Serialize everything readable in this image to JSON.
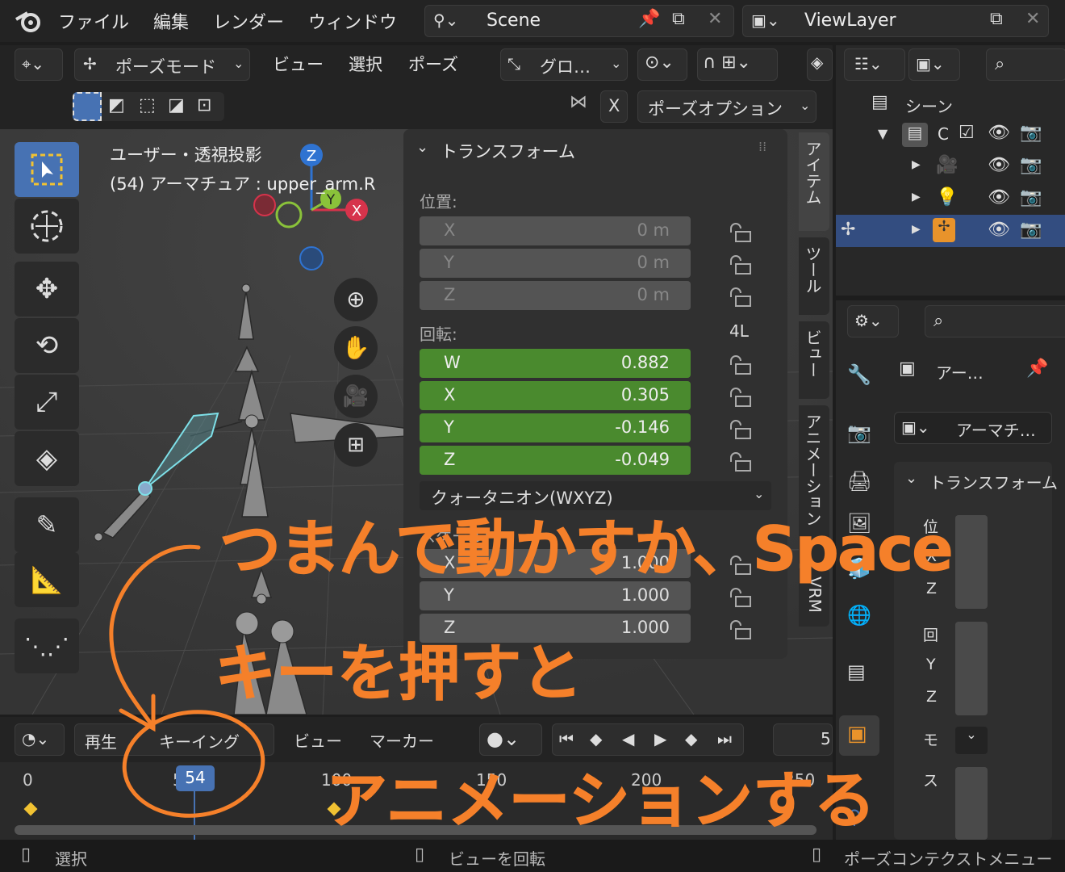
{
  "menu": {
    "file": "ファイル",
    "edit": "編集",
    "render": "レンダー",
    "window": "ウィンドウ"
  },
  "scene": {
    "name": "Scene",
    "view_layer": "ViewLayer"
  },
  "viewport_header": {
    "mode": "ポーズモード",
    "view": "ビュー",
    "select": "選択",
    "pose": "ポーズ",
    "orientation": "グロ…",
    "x_mirror": "X",
    "pose_options": "ポーズオプション"
  },
  "viewport": {
    "view_name": "ユーザー・透視投影",
    "object_info": "(54) アーマチュア : upper_arm.R"
  },
  "gizmo": {
    "z": "Z",
    "y": "Y",
    "x": "X"
  },
  "transform": {
    "title": "トランスフォーム",
    "location_label": "位置:",
    "location": [
      {
        "axis": "X",
        "value": "0 m"
      },
      {
        "axis": "Y",
        "value": "0 m"
      },
      {
        "axis": "Z",
        "value": "0 m"
      }
    ],
    "rotation_label": "回転:",
    "rotation_mode_short": "4L",
    "rotation": [
      {
        "axis": "W",
        "value": "0.882"
      },
      {
        "axis": "X",
        "value": "0.305"
      },
      {
        "axis": "Y",
        "value": "-0.146"
      },
      {
        "axis": "Z",
        "value": "-0.049"
      }
    ],
    "rotation_mode": "クォータニオン(WXYZ)",
    "scale_label": "スケール:",
    "scale": [
      {
        "axis": "X",
        "value": "1.000"
      },
      {
        "axis": "Y",
        "value": "1.000"
      },
      {
        "axis": "Z",
        "value": "1.000"
      }
    ]
  },
  "side_tabs": {
    "item": "アイテム",
    "tool": "ツール",
    "view": "ビュー",
    "animation": "アニメーション",
    "vrm": "VRM"
  },
  "outliner": {
    "scene": "シーン",
    "collection": "C"
  },
  "properties": {
    "name": "アー…",
    "data_name": "アーマチ…",
    "transform": "トランスフォーム",
    "rows": [
      "位",
      "X",
      "Y",
      "Z",
      "回",
      "Y",
      "Z",
      "モ",
      "ス"
    ]
  },
  "timeline": {
    "playback": "再生",
    "keying": "キーイング",
    "view": "ビュー",
    "marker": "マーカー",
    "current_frame": "54",
    "end_frame_partial": "5",
    "ticks": [
      "0",
      "50",
      "100",
      "150",
      "200",
      "250"
    ]
  },
  "status": {
    "select": "選択",
    "rotate_view": "ビューを回転",
    "context_menu": "ポーズコンテクストメニュー"
  },
  "annotation": {
    "line1": "つまんで動かすか、Space",
    "line2": "キーを押すと",
    "line3": "アニメーションする"
  },
  "colors": {
    "accent": "#4772b3",
    "green_field": "#4a8a2e",
    "annotation": "#f5802a",
    "axis_x": "#d6334b",
    "axis_y": "#8ac23a",
    "axis_z": "#2f73d1"
  }
}
